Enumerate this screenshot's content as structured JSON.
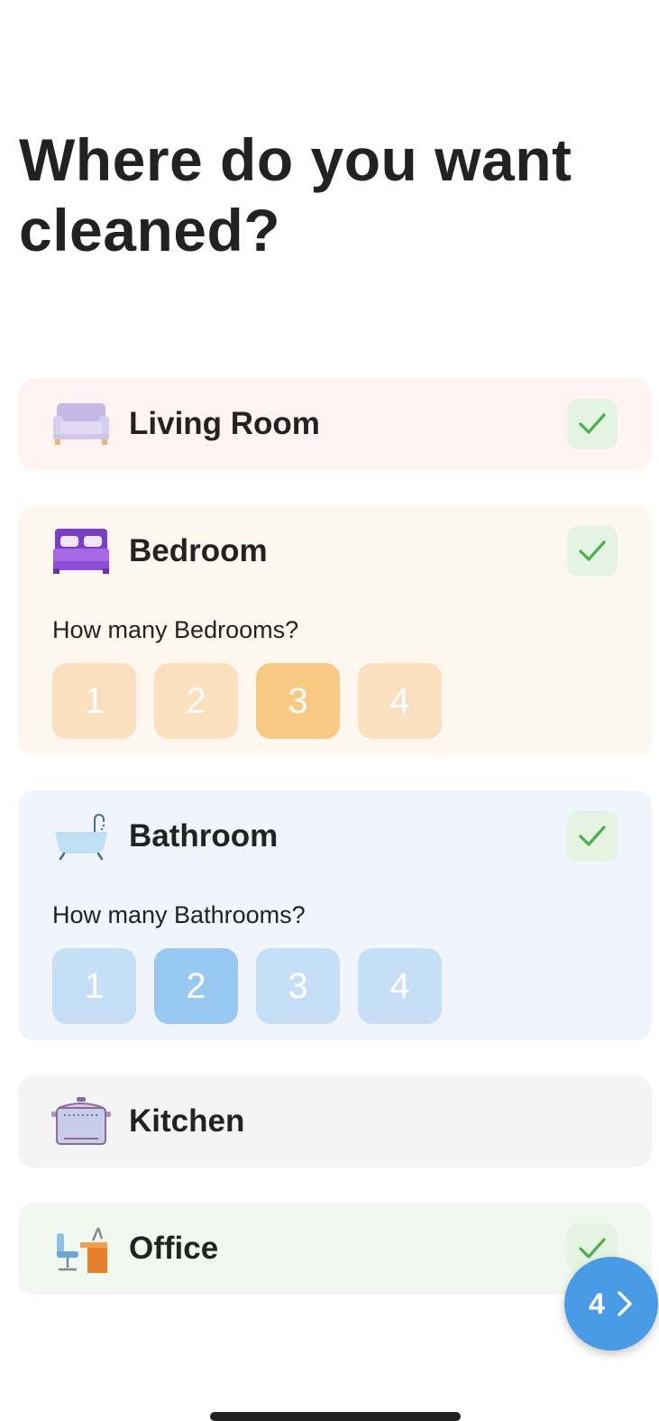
{
  "page": {
    "title": "Where do you want cleaned?"
  },
  "rooms": [
    {
      "label": "Living Room",
      "icon": "sofa-icon",
      "selected": true,
      "background": "#fff3f3"
    },
    {
      "label": "Bedroom",
      "icon": "bed-icon",
      "selected": true,
      "background": "#fdf7ef",
      "question": "How many Bedrooms?",
      "options": [
        "1",
        "2",
        "3",
        "4"
      ],
      "selected_option": "3",
      "option_color": "#fae0bf",
      "option_selected_color": "#f7c982"
    },
    {
      "label": "Bathroom",
      "icon": "bathtub-icon",
      "selected": true,
      "background": "#f0f5fd",
      "question": "How many Bathrooms?",
      "options": [
        "1",
        "2",
        "3",
        "4"
      ],
      "selected_option": "2",
      "option_color": "#c6dff6",
      "option_selected_color": "#99c8f2"
    },
    {
      "label": "Kitchen",
      "icon": "cooking-pot-icon",
      "selected": false,
      "background": "#f4f4f4"
    },
    {
      "label": "Office",
      "icon": "office-desk-icon",
      "selected": true,
      "background": "#f0f8f0"
    }
  ],
  "check_color": "#4caf50",
  "fab": {
    "count": "4",
    "icon": "chevron-right-icon",
    "color": "#4a9be6"
  }
}
